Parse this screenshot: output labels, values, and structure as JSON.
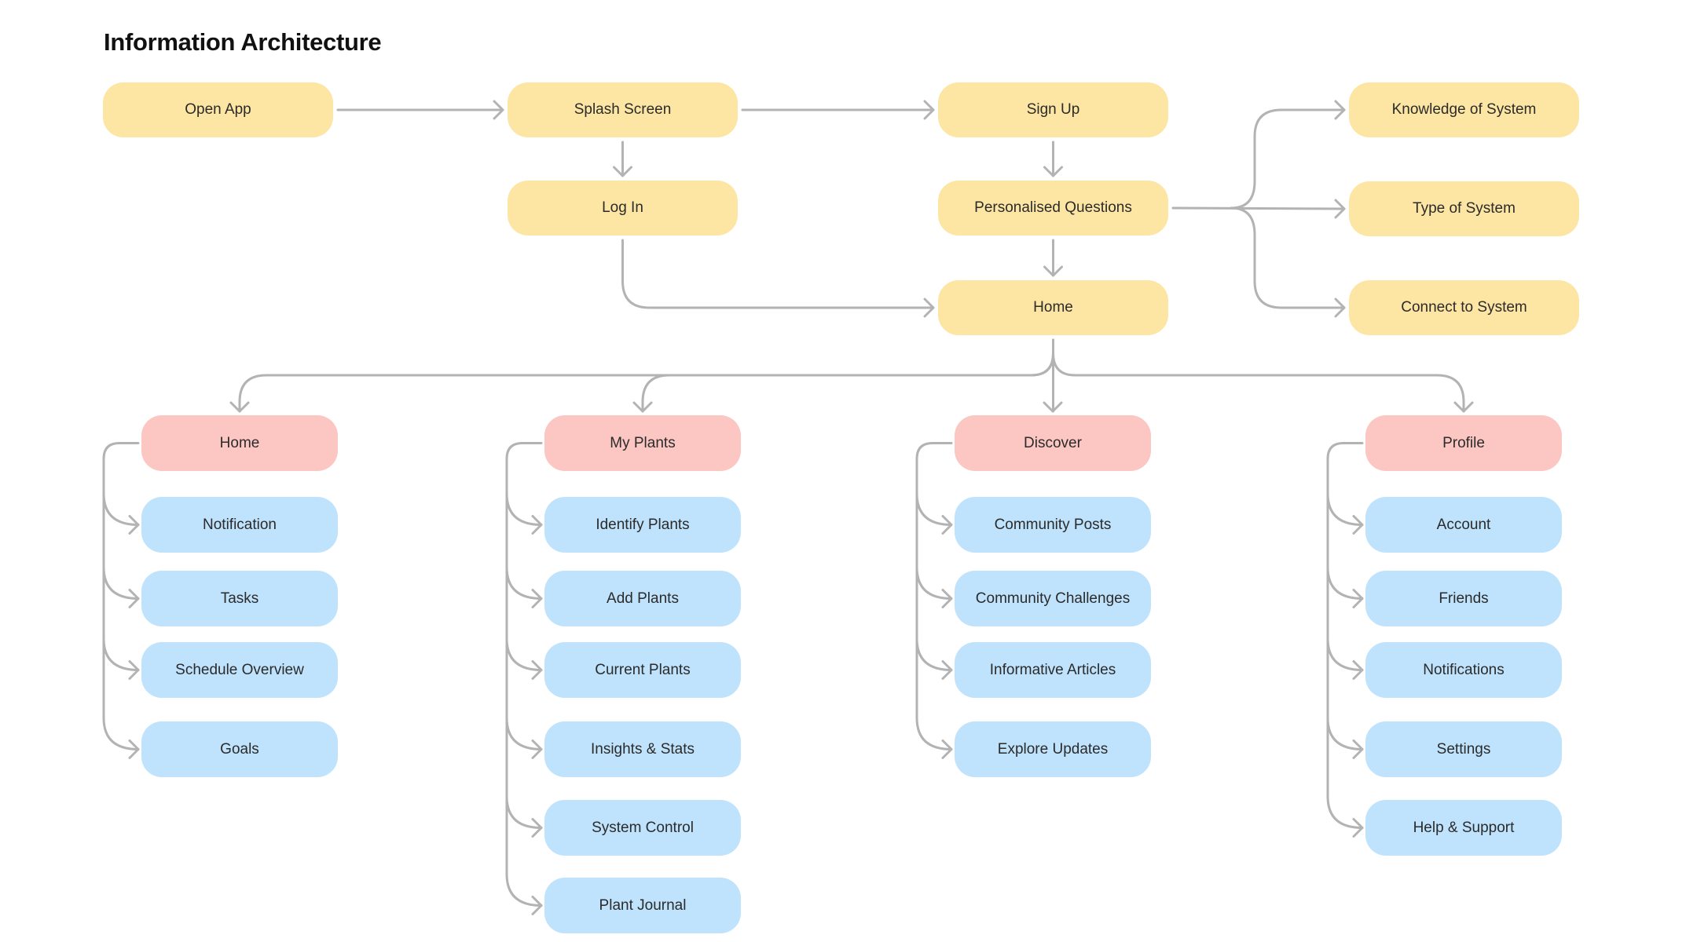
{
  "title": "Information Architecture",
  "colors": {
    "flow_node": "#fde6a3",
    "section_node": "#fcc7c2",
    "page_node": "#bfe3fc",
    "connector": "#b3b3b3",
    "text": "#2b2b2b"
  },
  "flow": {
    "open_app": "Open App",
    "splash_screen": "Splash Screen",
    "sign_up": "Sign Up",
    "log_in": "Log In",
    "personalised_questions": "Personalised Questions",
    "home": "Home",
    "knowledge_of_system": "Knowledge of System",
    "type_of_system": "Type of System",
    "connect_to_system": "Connect to System"
  },
  "sections": [
    {
      "label": "Home",
      "children": [
        "Notification",
        "Tasks",
        "Schedule Overview",
        "Goals"
      ]
    },
    {
      "label": "My Plants",
      "children": [
        "Identify Plants",
        "Add Plants",
        "Current Plants",
        "Insights & Stats",
        "System Control",
        "Plant Journal"
      ]
    },
    {
      "label": "Discover",
      "children": [
        "Community Posts",
        "Community Challenges",
        "Informative Articles",
        "Explore Updates"
      ]
    },
    {
      "label": "Profile",
      "children": [
        "Account",
        "Friends",
        "Notifications",
        "Settings",
        "Help & Support"
      ]
    }
  ],
  "edges": [
    [
      "open_app",
      "splash_screen"
    ],
    [
      "splash_screen",
      "sign_up"
    ],
    [
      "splash_screen",
      "log_in"
    ],
    [
      "sign_up",
      "personalised_questions"
    ],
    [
      "personalised_questions",
      "home"
    ],
    [
      "log_in",
      "home"
    ],
    [
      "personalised_questions",
      "knowledge_of_system"
    ],
    [
      "personalised_questions",
      "type_of_system"
    ],
    [
      "personalised_questions",
      "connect_to_system"
    ],
    [
      "home",
      "sections"
    ]
  ]
}
